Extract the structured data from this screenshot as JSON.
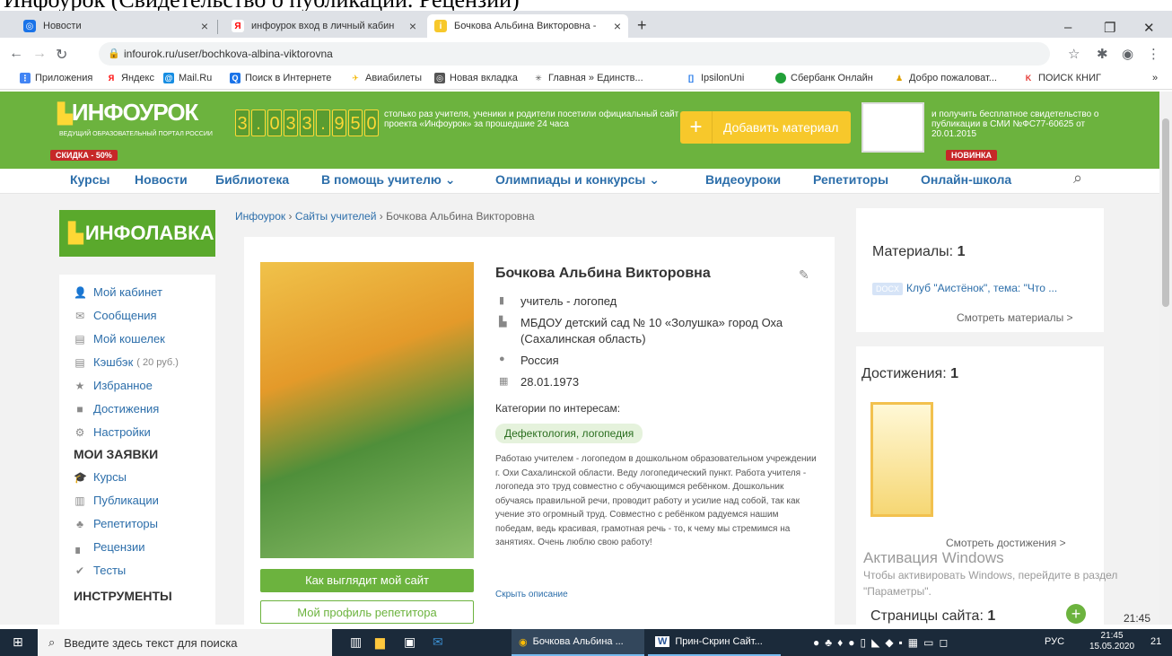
{
  "doc_caption": "Инфоурок (Свидетельство о публикации. Рецензии)",
  "browser": {
    "tabs": [
      {
        "label": "Новости",
        "active": false
      },
      {
        "label": "инфоурок вход в личный кабин",
        "active": false
      },
      {
        "label": "Бочкова Альбина Викторовна -",
        "active": true
      }
    ],
    "url": "infourok.ru/user/bochkova-albina-viktorovna",
    "bookmarks": [
      "Приложения",
      "Яндекс",
      "Mail.Ru",
      "Поиск в Интернете",
      "Авиабилеты",
      "Новая вкладка",
      "Главная » Единств...",
      "IpsilonUni",
      "Сбербанк Онлайн",
      "Добро пожаловат...",
      "ПОИСК КНИГ"
    ]
  },
  "header": {
    "logo": "ИНФОУРОК",
    "logo_sub": "ВЕДУЩИЙ ОБРАЗОВАТЕЛЬНЫЙ ПОРТАЛ РОССИИ",
    "counter_digits": [
      "3",
      ".",
      "0",
      "3",
      "3",
      ".",
      "9",
      "5",
      "0"
    ],
    "counter_text": "столько раз учителя, ученики и родители посетили официальный сайт проекта «Инфоурок» за прошедшие 24 часа",
    "add_button": "Добавить материал",
    "cert_text": "и получить бесплатное свидетельство о публикации в СМИ №ФС77-60625 от 20.01.2015",
    "badge_discount": "СКИДКА - 50%",
    "badge_new": "НОВИНКА"
  },
  "nav": [
    "Курсы",
    "Новости",
    "Библиотека",
    "В помощь учителю ⌄",
    "Олимпиады и конкурсы ⌄",
    "Видеоуроки",
    "Репетиторы",
    "Онлайн-школа"
  ],
  "left": {
    "infolavka": "ИНФОЛАВКА",
    "menu": [
      {
        "label": "Мой кабинет",
        "note": ""
      },
      {
        "label": "Сообщения",
        "note": ""
      },
      {
        "label": "Мой кошелек",
        "note": ""
      },
      {
        "label": "Кэшбэк",
        "note": "( 20 руб.)"
      },
      {
        "label": "Избранное",
        "note": ""
      },
      {
        "label": "Достижения",
        "note": ""
      },
      {
        "label": "Настройки",
        "note": ""
      }
    ],
    "requests_heading": "МОИ ЗАЯВКИ",
    "requests": [
      "Курсы",
      "Публикации",
      "Репетиторы",
      "Рецензии",
      "Тесты"
    ],
    "tools_heading": "ИНСТРУМЕНТЫ"
  },
  "breadcrumb": {
    "home": "Инфоурок",
    "section": "Сайты учителей",
    "current": "Бочкова Альбина Викторовна"
  },
  "profile": {
    "name": "Бочкова Альбина Викторовна",
    "role": "учитель - логопед",
    "org": "МБДОУ детский сад № 10 «Золушка» город Оха",
    "org_region": "(Сахалинская область)",
    "country": "Россия",
    "birthdate": "28.01.1973",
    "categories_heading": "Категории по интересам:",
    "category": "Дефектология, логопедия",
    "description": "Работаю учителем - логопедом в дошкольном образовательном учреждении г. Охи Сахалинской области. Веду логопедический пункт. Работа учителя - логопеда это труд совместно с обучающимся ребёнком. Дошкольник обучаясь правильной речи, проводит работу и усилие над собой, так как учение это огромный труд. Совместно с ребёнком радуемся нашим победам, ведь красивая, грамотная речь - то, к чему мы стремимся на занятиях. Очень люблю свою работу!",
    "hide_desc": "Скрыть описание",
    "btn_site": "Как выглядит мой сайт",
    "btn_tutor": "Мой профиль репетитора"
  },
  "right": {
    "materials_label": "Материалы:",
    "materials_count": "1",
    "material_tag": "DOCX",
    "material_title": "Клуб \"Аистёнок\", тема: \"Что ...",
    "materials_link": "Смотреть материалы >",
    "achievements_label": "Достижения:",
    "achievements_count": "1",
    "achievements_link": "Смотреть достижения >",
    "pages_label": "Страницы сайта:",
    "pages_count": "1"
  },
  "watermark": {
    "title": "Активация Windows",
    "text": "Чтобы активировать Windows, перейдите в раздел \"Параметры\"."
  },
  "taskbar": {
    "search": "Введите здесь текст для поиска",
    "app1": "Бочкова Альбина ...",
    "app2": "Прин-Скрин Сайт...",
    "lang": "РУС",
    "time": "21:45",
    "date": "15.05.2020",
    "side_time": "21:45",
    "notif": "21"
  },
  "colors": {
    "brand_green": "#6cb33e",
    "accent_yellow": "#f7c82b",
    "link_blue": "#2c6eaa"
  }
}
